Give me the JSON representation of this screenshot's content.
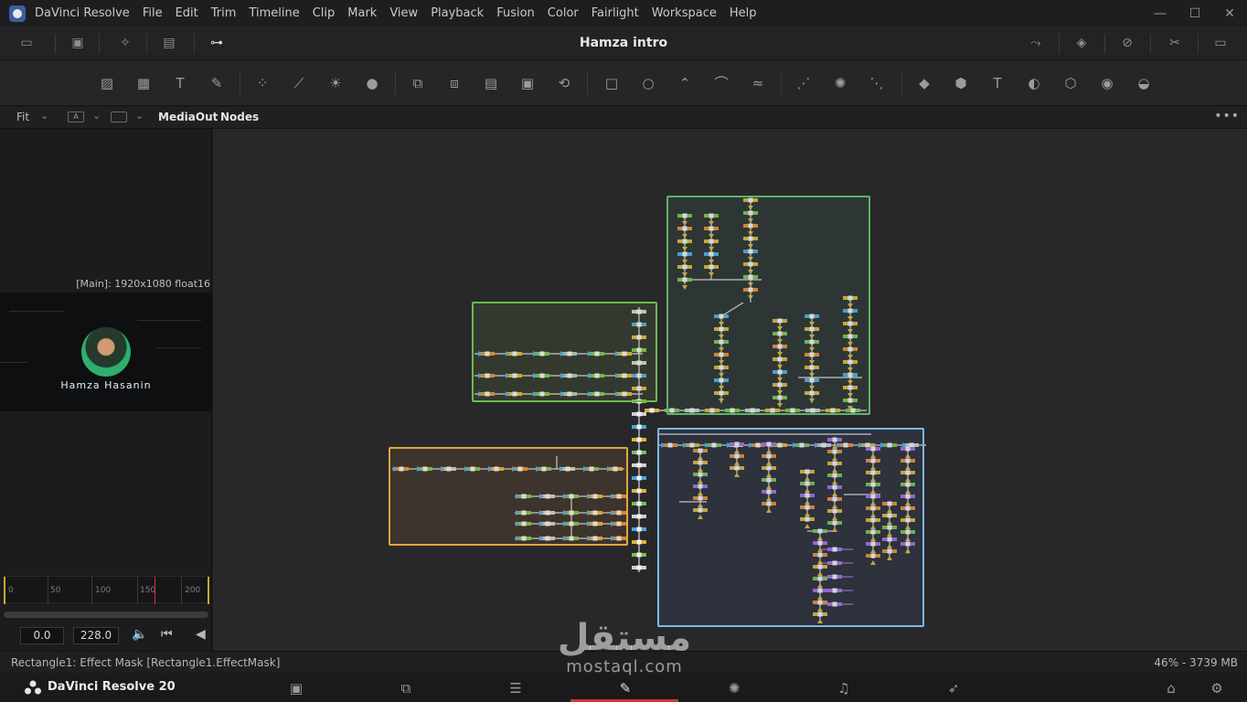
{
  "menubar": {
    "app_name": "DaVinci Resolve",
    "items": [
      "File",
      "Edit",
      "Trim",
      "Timeline",
      "Clip",
      "Mark",
      "View",
      "Playback",
      "Fusion",
      "Color",
      "Fairlight",
      "Workspace",
      "Help"
    ],
    "window_controls": [
      "—",
      "☐",
      "✕"
    ]
  },
  "titlebar": {
    "project_title": "Hamza intro"
  },
  "subbar": {
    "fit_label": "Fit",
    "channel_label": "A",
    "viewer_label": "MediaOut",
    "panel_label": "Nodes",
    "more": "•••"
  },
  "viewer": {
    "resolution": "[Main]: 1920x1080 float16",
    "overlay_name": "Hamza Hasanin",
    "ruler_ticks": [
      "0",
      "50",
      "100",
      "150",
      "200"
    ],
    "start_time": "0.0",
    "end_time": "228.0"
  },
  "status": {
    "left": "Rectangle1: Effect Mask   [Rectangle1.EffectMask]",
    "right": "46% - 3739 MB"
  },
  "pagebar": {
    "brand": "DaVinci Resolve 20"
  },
  "watermark": {
    "arabic": "مستقل",
    "latin": "mostaql.com"
  },
  "colors": {
    "group_green": "#6dbb4a",
    "group_orange": "#e3a640",
    "group_blue": "#7fb6e6",
    "group_teal": "#5fb36a",
    "active_page": "#d7342d"
  }
}
